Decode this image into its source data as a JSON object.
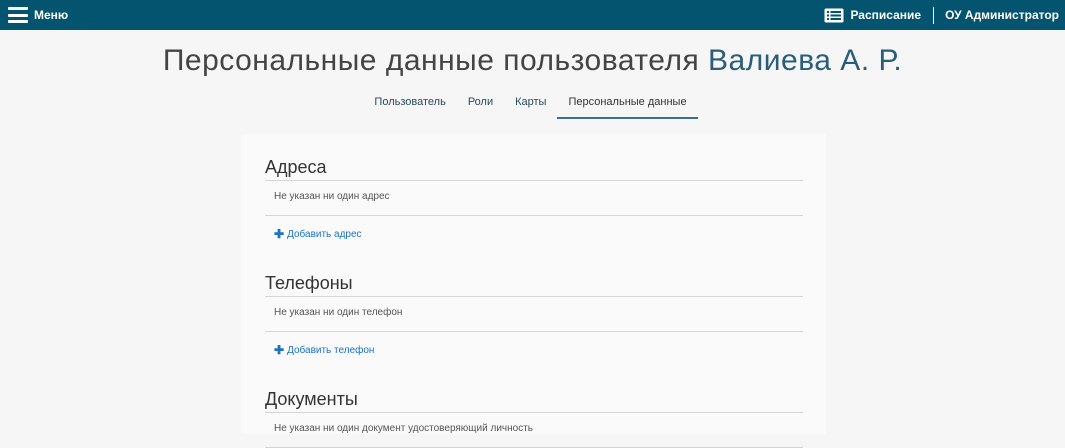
{
  "topbar": {
    "menu_label": "Меню",
    "schedule_label": "Расписание",
    "admin_label": "ОУ Администратор",
    "bg_color": "#04536f"
  },
  "header": {
    "title_prefix": "Персональные данные пользователя",
    "title_user": "Валиева А. Р."
  },
  "tabs": [
    {
      "label": "Пользователь",
      "active": false
    },
    {
      "label": "Роли",
      "active": false
    },
    {
      "label": "Карты",
      "active": false
    },
    {
      "label": "Персональные данные",
      "active": true
    }
  ],
  "sections": {
    "addresses": {
      "title": "Адреса",
      "empty": "Не указан ни один адрес",
      "add_label": "Добавить адрес"
    },
    "phones": {
      "title": "Телефоны",
      "empty": "Не указан ни один телефон",
      "add_label": "Добавить телефон"
    },
    "documents": {
      "title": "Документы",
      "empty": "Не указан ни один документ удостоверяющий личность"
    }
  },
  "icons": {
    "menu": "hamburger-icon",
    "schedule": "list-icon",
    "add": "plus-icon"
  }
}
